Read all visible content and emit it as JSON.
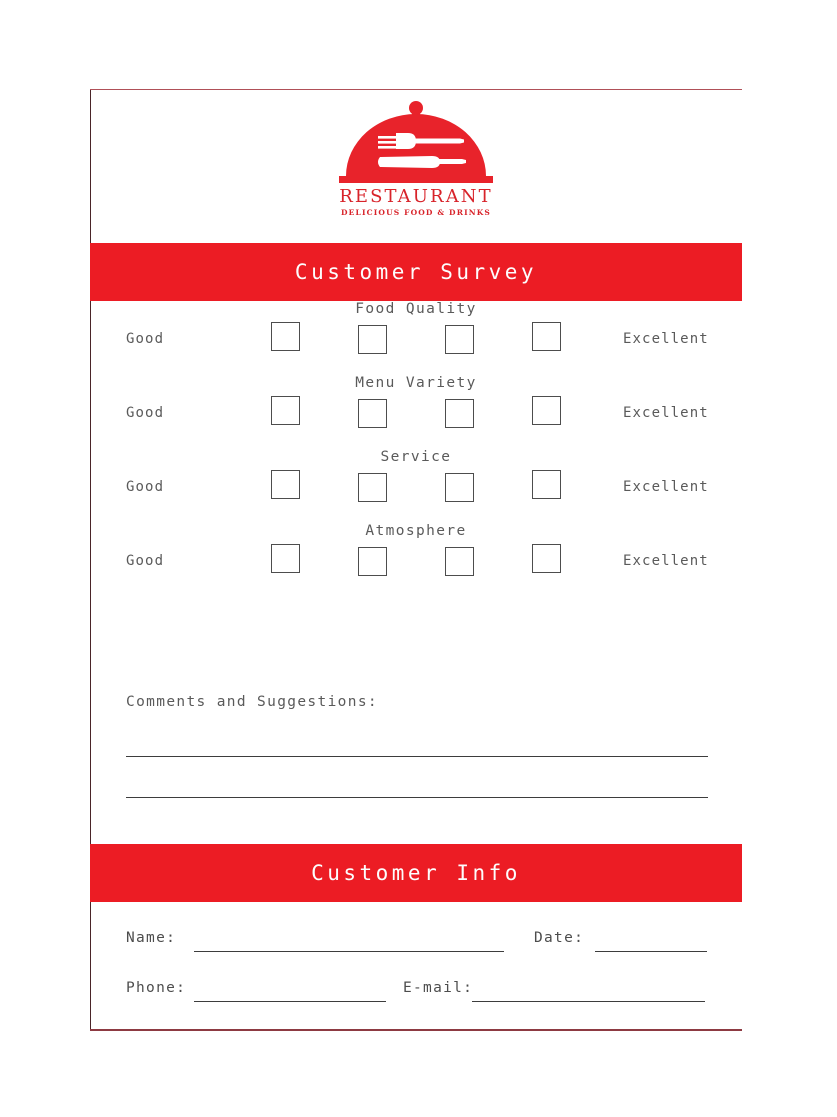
{
  "document": {
    "type": "restaurant-customer-survey-form",
    "page_background": "#ffffff",
    "accent_color": "#ec1c24",
    "text_color": "#5a5a5a",
    "line_color": "#3d3d3d"
  },
  "logo": {
    "icon": "food-dome-cloche-icon",
    "brand_name": "RESTAURANT",
    "tagline": "DELICIOUS FOOD & DRINKS",
    "color": "#d8232a"
  },
  "banners": {
    "survey": "Customer Survey",
    "info": "Customer Info"
  },
  "survey": {
    "scale_low_label": "Good",
    "scale_high_label": "Excellent",
    "checkbox_count": 4,
    "ratings": [
      {
        "title": "Food Quality",
        "low": "Good",
        "high": "Excellent"
      },
      {
        "title": "Menu Variety",
        "low": "Good",
        "high": "Excellent"
      },
      {
        "title": "Service",
        "low": "Good",
        "high": "Excellent"
      },
      {
        "title": "Atmosphere",
        "low": "Good",
        "high": "Excellent"
      }
    ],
    "comments_label": "Comments and Suggestions:",
    "comment_lines": 2
  },
  "customer_info": {
    "fields": [
      {
        "label": "Name:",
        "value": ""
      },
      {
        "label": "Date:",
        "value": ""
      },
      {
        "label": "Phone:",
        "value": ""
      },
      {
        "label": "E-mail:",
        "value": ""
      }
    ]
  }
}
